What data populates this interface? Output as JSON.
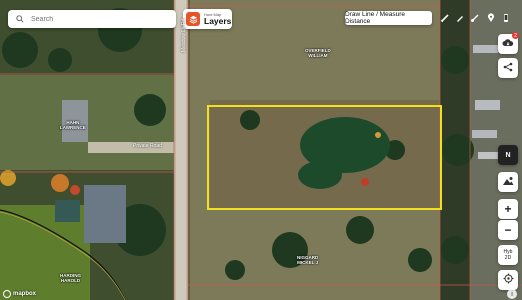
{
  "search": {
    "placeholder": "Search"
  },
  "layers": {
    "small_label": "Hunt Map",
    "label": "Layers",
    "accent": "#e8542a"
  },
  "toolbar": {
    "measure_label": "Draw Line / Measure Distance",
    "tools": [
      "pencil-icon",
      "pen-icon",
      "brush-icon",
      "pin-icon",
      "phone-icon"
    ]
  },
  "right_controls": {
    "notification_count": "2",
    "compass_label": "N",
    "zoom_in": "+",
    "zoom_out": "−",
    "mode_label": "Hyb",
    "view_label": "2D"
  },
  "parcels": [
    {
      "line1": "OVERFIELD",
      "line2": "WILLIAM"
    },
    {
      "line1": "HAHN",
      "line2": "LAWRENCE"
    },
    {
      "line1": "NIGGARD",
      "line2": "MICKEL J"
    },
    {
      "line1": "HARDING",
      "line2": "HAROLD"
    }
  ],
  "roads": {
    "vertical": "Meadow Lk Rd",
    "private": "Private Road"
  },
  "attribution": {
    "brand": "mapbox",
    "info": "i"
  },
  "colors": {
    "selection": "#f0e020",
    "parcel_line": "#c85a4a"
  }
}
